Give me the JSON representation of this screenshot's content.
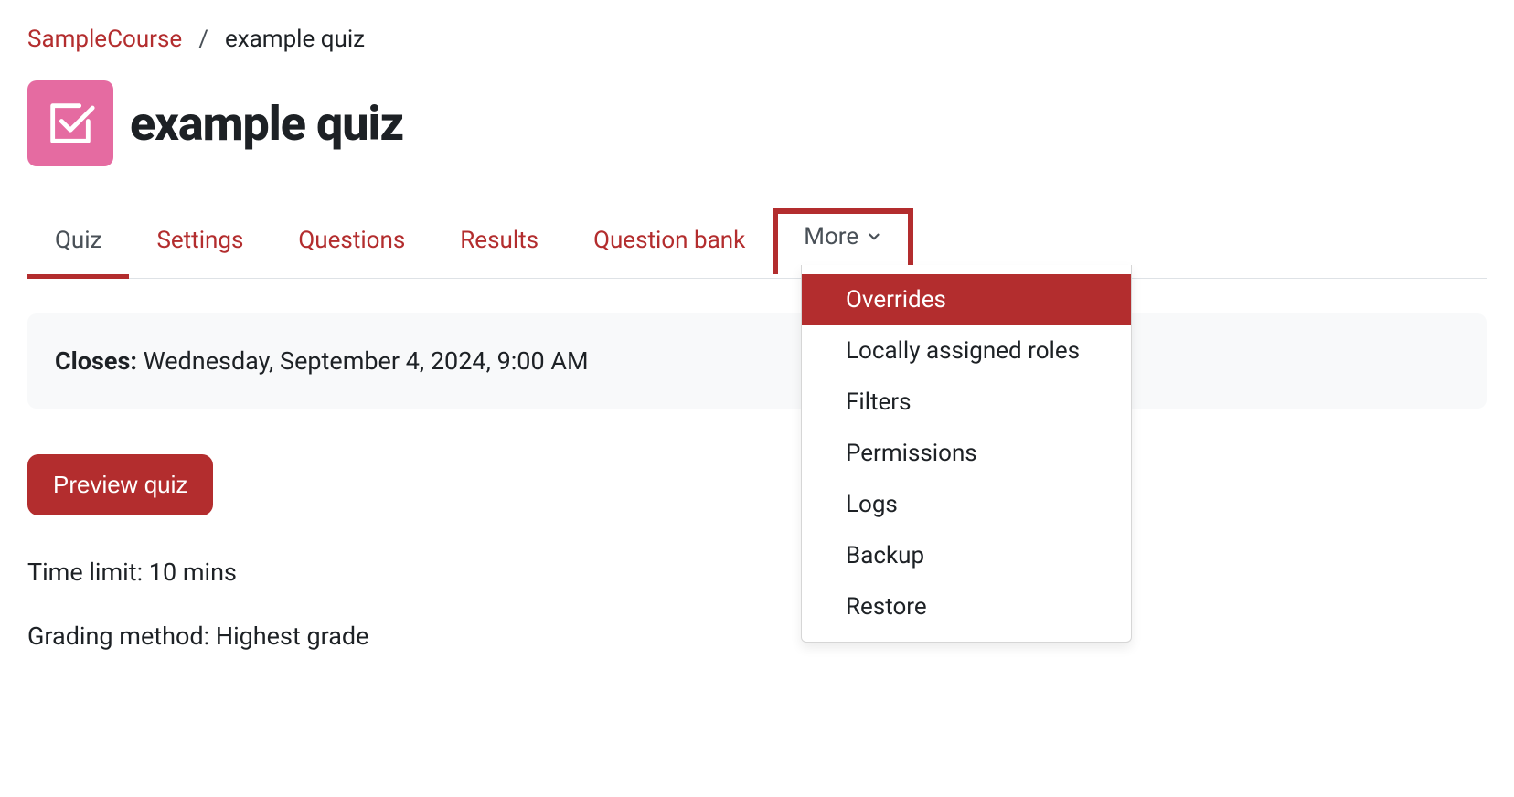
{
  "breadcrumb": {
    "course": "SampleCourse",
    "separator": "/",
    "current": "example quiz"
  },
  "page_title": "example quiz",
  "tabs": {
    "quiz": "Quiz",
    "settings": "Settings",
    "questions": "Questions",
    "results": "Results",
    "question_bank": "Question bank",
    "more": "More"
  },
  "info": {
    "closes_label": "Closes:",
    "closes_value": "Wednesday, September 4, 2024, 9:00 AM"
  },
  "preview_button": "Preview quiz",
  "details": {
    "time_limit": "Time limit: 10 mins",
    "grading_method": "Grading method: Highest grade"
  },
  "more_menu": {
    "overrides": "Overrides",
    "locally_assigned_roles": "Locally assigned roles",
    "filters": "Filters",
    "permissions": "Permissions",
    "logs": "Logs",
    "backup": "Backup",
    "restore": "Restore"
  }
}
